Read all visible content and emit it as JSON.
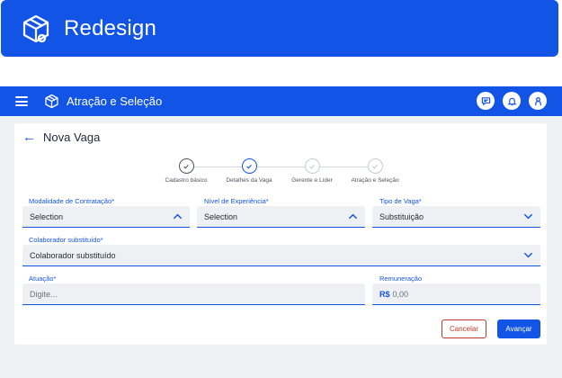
{
  "hero": {
    "title": "Redesign"
  },
  "appbar": {
    "title": "Atração e Seleção"
  },
  "page": {
    "title": "Nova Vaga"
  },
  "stepper": {
    "steps": [
      {
        "label": "Cadastro básico",
        "state": "done"
      },
      {
        "label": "Detalhes da Vaga",
        "state": "active"
      },
      {
        "label": "Gerente e Líder",
        "state": "pending"
      },
      {
        "label": "Atração e Seleção",
        "state": "pending"
      }
    ]
  },
  "form": {
    "modalidade": {
      "label": "Modalidade de Contratação*",
      "value": "Selection",
      "chevron": "up"
    },
    "nivel": {
      "label": "Nível de Experiência*",
      "value": "Selection",
      "chevron": "up"
    },
    "tipo": {
      "label": "Tipo de Vaga*",
      "value": "Substituição",
      "chevron": "down"
    },
    "colaborador": {
      "label": "Colaborador substituído*",
      "value": "Colaborador substituído",
      "chevron": "down"
    },
    "atuacao": {
      "label": "Atuação*",
      "placeholder": "Digite..."
    },
    "remuneracao": {
      "label": "Remuneração",
      "currency": "R$",
      "placeholder": "0,00"
    }
  },
  "actions": {
    "cancel": "Cancelar",
    "next": "Avançar"
  },
  "colors": {
    "primary": "#1254e6",
    "danger": "#c0392b",
    "field_bg": "#eef0f3",
    "canvas_bg": "#f0f1f3"
  }
}
